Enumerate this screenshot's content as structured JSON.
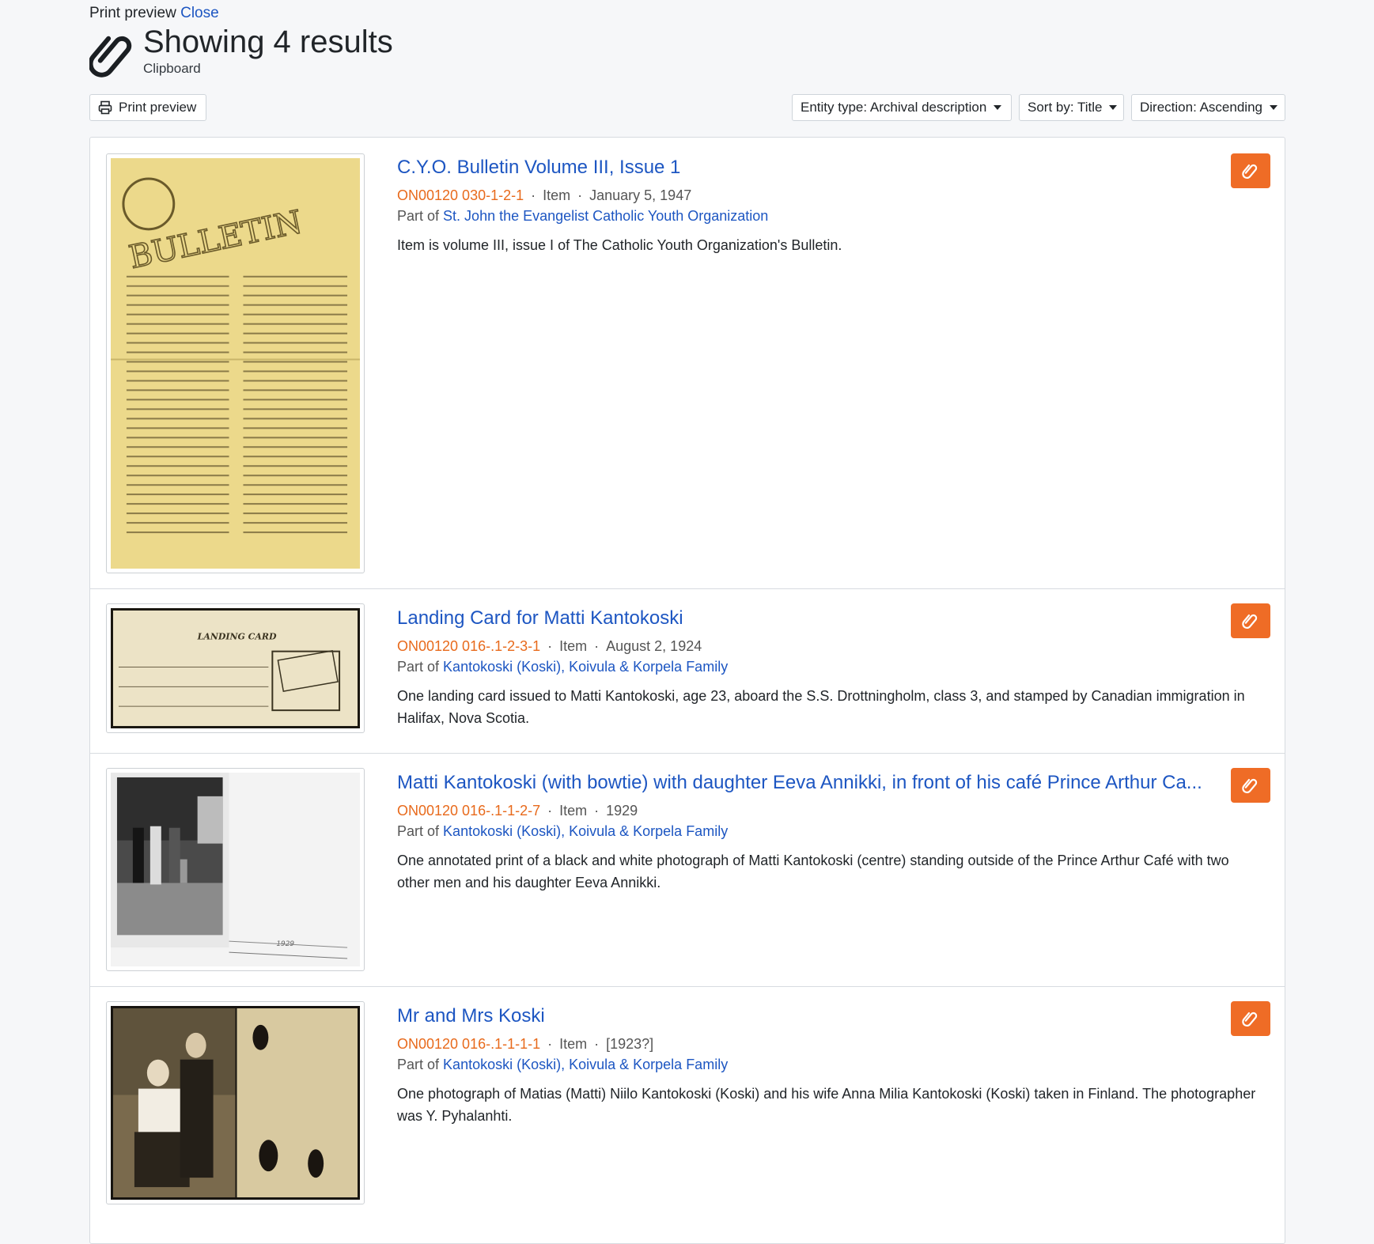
{
  "header": {
    "print_preview_label": "Print preview",
    "close_link": "Close",
    "title": "Showing 4 results",
    "subtitle": "Clipboard"
  },
  "toolbar": {
    "print_button": "Print preview",
    "entity_type": "Entity type: Archival description",
    "sort_by": "Sort by: Title",
    "direction": "Direction: Ascending"
  },
  "results": [
    {
      "title": "C.Y.O. Bulletin Volume III, Issue 1",
      "reference": "ON00120 030-1-2-1",
      "level": "Item",
      "date": "January 5, 1947",
      "part_of_label": "Part of",
      "part_of": "St. John the Evangelist Catholic Youth Organization",
      "description": "Item is volume III, issue I of The Catholic Youth Organization's Bulletin.",
      "thumb_text": "BULLETIN"
    },
    {
      "title": "Landing Card for Matti Kantokoski",
      "reference": "ON00120 016-.1-2-3-1",
      "level": "Item",
      "date": "August 2, 1924",
      "part_of_label": "Part of",
      "part_of": "Kantokoski (Koski), Koivula & Korpela Family",
      "description": "One landing card issued to Matti Kantokoski, age 23, aboard the S.S. Drottningholm, class 3, and stamped by Canadian immigration in Halifax, Nova Scotia.",
      "thumb_text": "LANDING CARD"
    },
    {
      "title": "Matti Kantokoski (with bowtie) with daughter Eeva Annikki, in front of his café Prince Arthur Ca...",
      "reference": "ON00120 016-.1-1-2-7",
      "level": "Item",
      "date": "1929",
      "part_of_label": "Part of",
      "part_of": "Kantokoski (Koski), Koivula & Korpela Family",
      "description": "One annotated print of a black and white photograph of Matti Kantokoski (centre) standing outside of the Prince Arthur Café with two other men and his daughter Eeva Annikki.",
      "thumb_text": "1929"
    },
    {
      "title": "Mr and Mrs Koski",
      "reference": "ON00120 016-.1-1-1-1",
      "level": "Item",
      "date": "[1923?]",
      "part_of_label": "Part of",
      "part_of": "Kantokoski (Koski), Koivula & Korpela Family",
      "description": "One photograph of Matias (Matti) Niilo Kantokoski (Koski) and his wife Anna Milia Kantokoski (Koski) taken in Finland. The photographer was Y. Pyhalanhti."
    }
  ],
  "icons": {
    "clipboard": "paperclip-icon",
    "print": "printer-icon",
    "accent": "#ef6c26",
    "link": "#1d56c2"
  }
}
